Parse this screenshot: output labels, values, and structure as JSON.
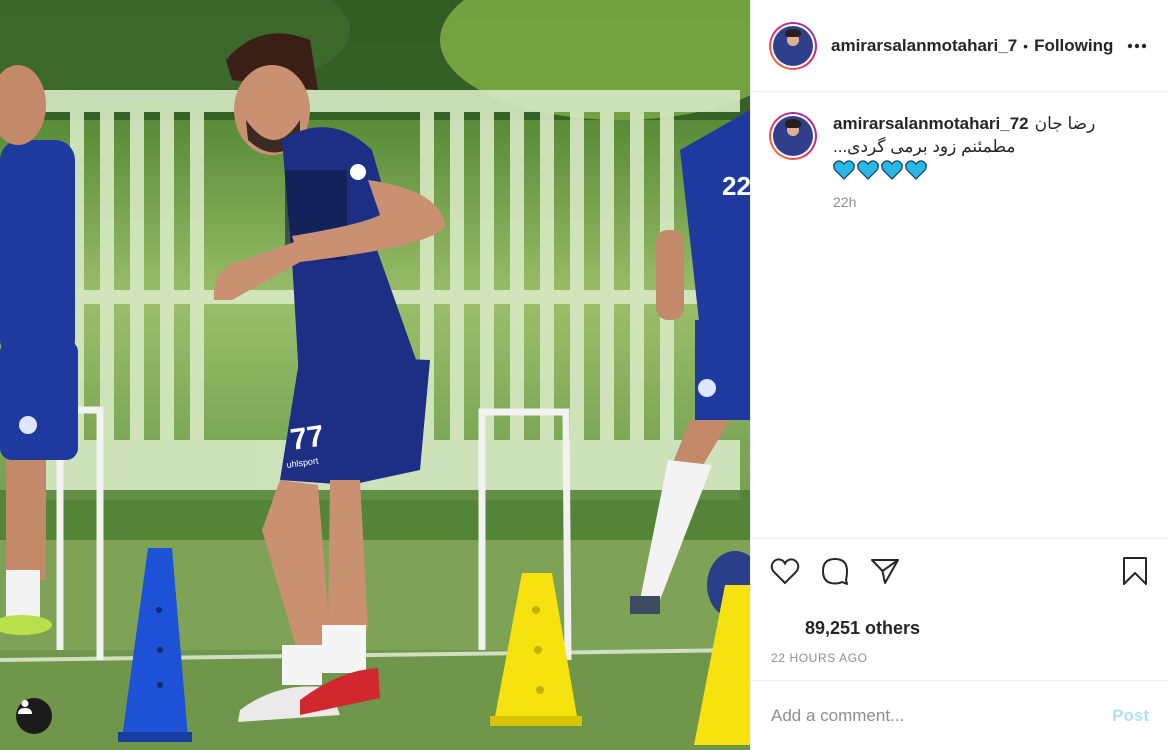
{
  "header": {
    "username": "amirarsalanmotahari_7",
    "separator": "•",
    "follow_status": "Following"
  },
  "caption": {
    "username": "amirarsalanmotahari_72",
    "text_line1": "رضا جان",
    "text_line2": "...مطمئنم زود برمی گردی",
    "emoji": "💙💙💙💙",
    "time_ago": "22h"
  },
  "photo": {
    "jersey_number": "77",
    "sponsor": "uhlsport",
    "side_player_number": "22"
  },
  "stats": {
    "likes_text": "89,251 others",
    "posted": "22 HOURS AGO"
  },
  "comment_box": {
    "placeholder": "Add a comment...",
    "post_label": "Post"
  },
  "icons": {
    "like": "heart-icon",
    "comment": "comment-icon",
    "share": "share-icon",
    "save": "bookmark-icon",
    "more": "more-icon",
    "tag": "user-tag-icon"
  },
  "colors": {
    "kit_blue": "#1f2f86",
    "emoji_blue": "#2bb6e8",
    "post_button": "#b2dffc",
    "muted_text": "#8e8e8e"
  }
}
